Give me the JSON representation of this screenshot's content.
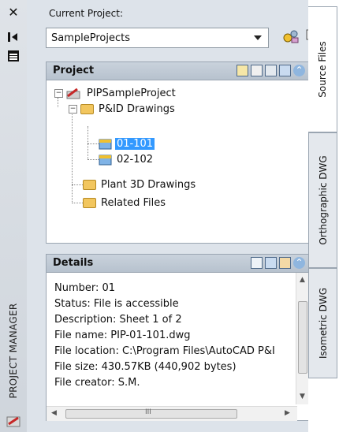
{
  "sidebar": {
    "title": "PROJECT MANAGER",
    "close_icon": "close-icon",
    "autohide_icon": "autohide-icon",
    "properties_icon": "properties-icon"
  },
  "current_project": {
    "label": "Current Project:",
    "value": "SampleProjects"
  },
  "project_panel": {
    "title": "Project",
    "tree": [
      {
        "label": "PIPSampleProject",
        "level": 0,
        "expanded": true
      },
      {
        "label": "P&ID Drawings",
        "level": 1,
        "expanded": true
      },
      {
        "label": "01-101",
        "level": 2,
        "selected": true
      },
      {
        "label": "02-102",
        "level": 2
      },
      {
        "label": "Plant 3D Drawings",
        "level": 1
      },
      {
        "label": "Related Files",
        "level": 1
      }
    ]
  },
  "details_panel": {
    "title": "Details",
    "lines": [
      "Number: 01",
      "Status: File is accessible",
      "Description: Sheet 1 of 2",
      "File name: PIP-01-101.dwg",
      "File location: C:\\Program Files\\AutoCAD P&I",
      "File size: 430.57KB (440,902 bytes)",
      "File creator: S.M."
    ],
    "hscroll_grip": "III"
  },
  "tabs": [
    {
      "label": "Source Files",
      "active": true
    },
    {
      "label": "Orthographic DWG",
      "active": false
    },
    {
      "label": "Isometric DWG",
      "active": false
    }
  ],
  "colors": {
    "selection": "#3399ff",
    "panel_header": "#c1cbd6",
    "folder": "#f2c65e"
  }
}
